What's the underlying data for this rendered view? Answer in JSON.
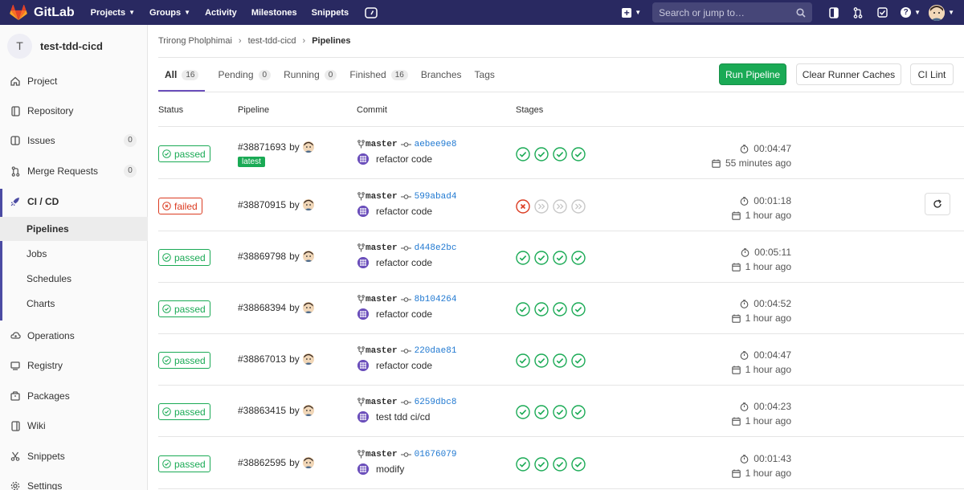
{
  "navbar": {
    "brand": "GitLab",
    "links": [
      {
        "label": "Projects",
        "dropdown": true
      },
      {
        "label": "Groups",
        "dropdown": true
      },
      {
        "label": "Activity",
        "dropdown": false
      },
      {
        "label": "Milestones",
        "dropdown": false
      },
      {
        "label": "Snippets",
        "dropdown": false
      }
    ],
    "search_placeholder": "Search or jump to…"
  },
  "sidebar": {
    "project_initial": "T",
    "project_name": "test-tdd-cicd",
    "items": [
      {
        "label": "Project",
        "icon": "home-icon"
      },
      {
        "label": "Repository",
        "icon": "book-icon"
      },
      {
        "label": "Issues",
        "icon": "issues-icon",
        "count": "0"
      },
      {
        "label": "Merge Requests",
        "icon": "merge-request-icon",
        "count": "0"
      },
      {
        "label": "CI / CD",
        "icon": "rocket-icon"
      },
      {
        "label": "Operations",
        "icon": "cloud-gear-icon"
      },
      {
        "label": "Registry",
        "icon": "container-icon"
      },
      {
        "label": "Packages",
        "icon": "package-icon"
      },
      {
        "label": "Wiki",
        "icon": "wiki-icon"
      },
      {
        "label": "Snippets",
        "icon": "snippet-icon"
      },
      {
        "label": "Settings",
        "icon": "settings-icon"
      }
    ],
    "ci_subitems": [
      "Pipelines",
      "Jobs",
      "Schedules",
      "Charts"
    ]
  },
  "breadcrumb": {
    "items": [
      "Trirong Pholphimai",
      "test-tdd-cicd",
      "Pipelines"
    ]
  },
  "tabs": [
    {
      "label": "All",
      "count": "16"
    },
    {
      "label": "Pending",
      "count": "0"
    },
    {
      "label": "Running",
      "count": "0"
    },
    {
      "label": "Finished",
      "count": "16"
    },
    {
      "label": "Branches",
      "count": ""
    },
    {
      "label": "Tags",
      "count": ""
    }
  ],
  "buttons": {
    "run": "Run Pipeline",
    "clear": "Clear Runner Caches",
    "lint": "CI Lint"
  },
  "table": {
    "headers": [
      "Status",
      "Pipeline",
      "Commit",
      "Stages"
    ],
    "rows": [
      {
        "status": "passed",
        "id": "#38871693",
        "by": "by",
        "latest": "latest",
        "branch": "master",
        "sha": "aebee9e8",
        "message": "refactor code",
        "stages": [
          "success",
          "success",
          "success",
          "success"
        ],
        "duration": "00:04:47",
        "ago": "55 minutes ago"
      },
      {
        "status": "failed",
        "id": "#38870915",
        "by": "by",
        "latest": "",
        "branch": "master",
        "sha": "599abad4",
        "message": "refactor code",
        "stages": [
          "failed",
          "skipped",
          "skipped",
          "skipped"
        ],
        "duration": "00:01:18",
        "ago": "1 hour ago"
      },
      {
        "status": "passed",
        "id": "#38869798",
        "by": "by",
        "latest": "",
        "branch": "master",
        "sha": "d448e2bc",
        "message": "refactor code",
        "stages": [
          "success",
          "success",
          "success",
          "success"
        ],
        "duration": "00:05:11",
        "ago": "1 hour ago"
      },
      {
        "status": "passed",
        "id": "#38868394",
        "by": "by",
        "latest": "",
        "branch": "master",
        "sha": "8b104264",
        "message": "refactor code",
        "stages": [
          "success",
          "success",
          "success",
          "success"
        ],
        "duration": "00:04:52",
        "ago": "1 hour ago"
      },
      {
        "status": "passed",
        "id": "#38867013",
        "by": "by",
        "latest": "",
        "branch": "master",
        "sha": "220dae81",
        "message": "refactor code",
        "stages": [
          "success",
          "success",
          "success",
          "success"
        ],
        "duration": "00:04:47",
        "ago": "1 hour ago"
      },
      {
        "status": "passed",
        "id": "#38863415",
        "by": "by",
        "latest": "",
        "branch": "master",
        "sha": "6259dbc8",
        "message": "test tdd ci/cd",
        "stages": [
          "success",
          "success",
          "success",
          "success"
        ],
        "duration": "00:04:23",
        "ago": "1 hour ago"
      },
      {
        "status": "passed",
        "id": "#38862595",
        "by": "by",
        "latest": "",
        "branch": "master",
        "sha": "01676079",
        "message": "modify",
        "stages": [
          "success",
          "success",
          "success",
          "success"
        ],
        "duration": "00:01:43",
        "ago": "1 hour ago"
      }
    ]
  },
  "colors": {
    "navbar": "#292961",
    "success": "#1aaa55",
    "failed": "#db3b21",
    "link": "#1f78d1",
    "active_tab": "#6b4fbb"
  }
}
